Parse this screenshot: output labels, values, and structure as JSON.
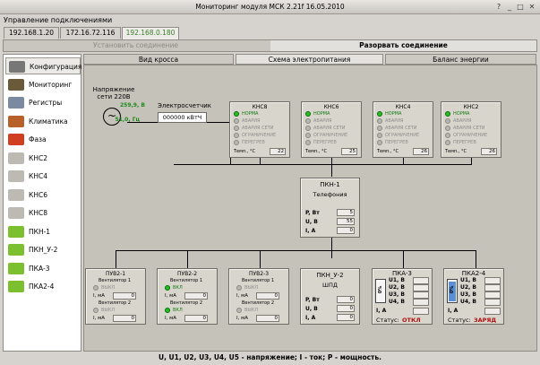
{
  "window": {
    "title": "Мониторинг модуля МСК 2.21f 16.05.2010",
    "controls": [
      "?",
      "_",
      "□",
      "✕"
    ]
  },
  "menu": {
    "label": "Управление подключениями"
  },
  "ip_tabs": [
    "192.168.1.20",
    "172.16.72.116",
    "192.168.0.180"
  ],
  "conn": {
    "connect": "Установить соединение",
    "disconnect": "Разорвать соединение"
  },
  "sidebar": [
    {
      "label": "Конфигурация",
      "icon": "wrench-icon"
    },
    {
      "label": "Мониторинг",
      "icon": "monitor-icon"
    },
    {
      "label": "Регистры",
      "icon": "register-icon"
    },
    {
      "label": "Климатика",
      "icon": "climate-icon"
    },
    {
      "label": "Фаза",
      "icon": "phase-icon"
    },
    {
      "label": "КНС2",
      "icon": "kns-icon"
    },
    {
      "label": "КНС4",
      "icon": "kns-icon"
    },
    {
      "label": "КНС6",
      "icon": "kns-icon"
    },
    {
      "label": "КНС8",
      "icon": "kns-icon"
    },
    {
      "label": "ПКН-1",
      "icon": "battery-icon"
    },
    {
      "label": "ПКН_У-2",
      "icon": "battery-icon"
    },
    {
      "label": "ПКА-3",
      "icon": "battery-icon"
    },
    {
      "label": "ПКА2-4",
      "icon": "battery-icon"
    }
  ],
  "view_tabs": [
    "Вид кросса",
    "Схема электропитания",
    "Баланс энергии"
  ],
  "mains": {
    "label1": "Напряжение",
    "label2": "сети 220В",
    "voltage": "259,9, В",
    "freq": "51,0, Гц"
  },
  "meter": {
    "label": "Электросчетчик",
    "value": "000000 кВтЧ"
  },
  "kns": [
    {
      "name": "КНС8",
      "temp": "22"
    },
    {
      "name": "КНС6",
      "temp": "25"
    },
    {
      "name": "КНС4",
      "temp": "26"
    },
    {
      "name": "КНС2",
      "temp": "26"
    }
  ],
  "kns_states": [
    "НОРМА",
    "АВАРИЯ",
    "АВАРИЯ СЕТИ",
    "ОГРАНИЧЕНИЕ",
    "ПЕРЕГРЕВ"
  ],
  "kns_temp_label": "Темп., °С",
  "pkn1": {
    "name": "ПКН-1",
    "sub": "Телефония",
    "rows": [
      {
        "k": "P, Вт",
        "v": "5"
      },
      {
        "k": "U, В",
        "v": "55"
      },
      {
        "k": "I, А",
        "v": "0"
      }
    ]
  },
  "puv": [
    {
      "name": "ПУВ2-1",
      "fan1": "Вентилятор 1",
      "st1": "ВЫКЛ",
      "i1": "0",
      "fan2": "Вентилятор 2",
      "st2": "ВЫКЛ",
      "i2": "0",
      "on1": false,
      "on2": false
    },
    {
      "name": "ПУВ2-2",
      "fan1": "Вентилятор 1",
      "st1": "ВКЛ",
      "i1": "0",
      "fan2": "Вентилятор 2",
      "st2": "ВКЛ",
      "i2": "0",
      "on1": true,
      "on2": true
    },
    {
      "name": "ПУВ2-3",
      "fan1": "Вентилятор 1",
      "st1": "ВЫКЛ",
      "i1": "0",
      "fan2": "Вентилятор 2",
      "st2": "ВЫКЛ",
      "i2": "0",
      "on1": false,
      "on2": false
    }
  ],
  "pkn2": {
    "name": "ПКН_У-2",
    "sub": "ШПД",
    "rows": [
      {
        "k": "P, Вт",
        "v": "0"
      },
      {
        "k": "U, В",
        "v": "0"
      },
      {
        "k": "I, А",
        "v": "0"
      }
    ]
  },
  "pka3": {
    "name": "ПКА-3",
    "pct": "0%",
    "rows": [
      "U1, В",
      "U2, В",
      "U3, В",
      "U4, В"
    ],
    "i": "I, A",
    "status_label": "Статус:",
    "status": "ОТКЛ"
  },
  "pka4": {
    "name": "ПКА2-4",
    "pct": "0%",
    "rows": [
      "U1, В",
      "U2, В",
      "U3, В",
      "U4, В"
    ],
    "i": "I, A",
    "status_label": "Статус:",
    "status": "ЗАРЯД"
  },
  "legend": "U, U1, U2, U3, U4, U5 - напряжение; I - ток; P - мощность.",
  "colors": {
    "green": "#22c020",
    "status_red": "#b01010",
    "active_tab": "#3a7d2a"
  }
}
